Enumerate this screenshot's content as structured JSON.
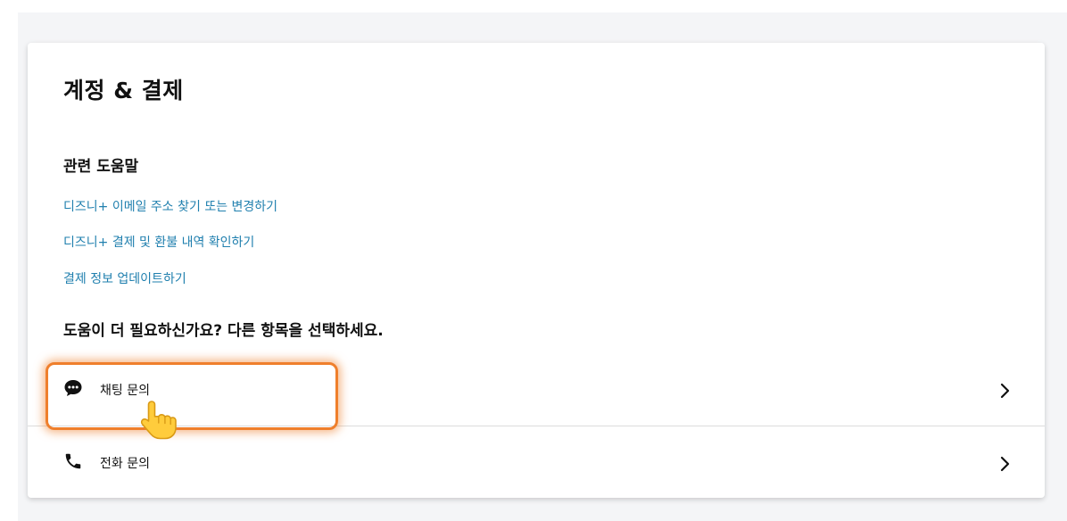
{
  "page": {
    "title": "계정 & 결제"
  },
  "related": {
    "heading": "관련 도움말",
    "links": [
      "디즈니+ 이메일 주소 찾기 또는 변경하기",
      "디즈니+ 결제 및 환불 내역 확인하기",
      "결제 정보 업데이트하기"
    ]
  },
  "more_help": {
    "heading": "도움이 더 필요하신가요? 다른 항목을 선택하세요.",
    "options": [
      {
        "label": "채팅 문의",
        "icon": "chat-bubble-icon"
      },
      {
        "label": "전화 문의",
        "icon": "phone-icon"
      }
    ]
  },
  "annotation": {
    "highlight_color": "#ef7f2c",
    "pointer_icon": "pointing-hand-icon"
  },
  "colors": {
    "link": "#1f7fae",
    "text": "#111111",
    "background": "#f4f5f7",
    "card": "#ffffff"
  }
}
